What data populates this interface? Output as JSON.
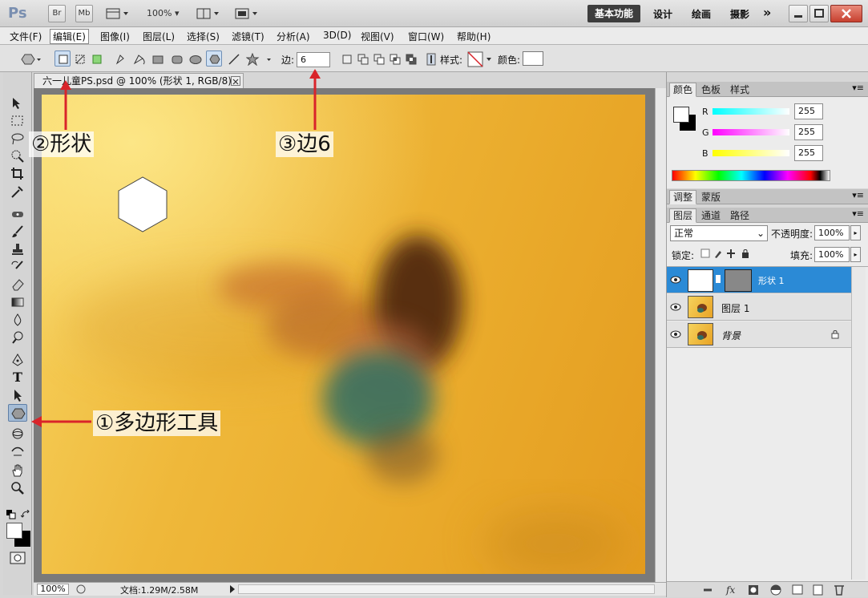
{
  "app": {
    "logo": "Ps",
    "bridge": "Br",
    "minibridge": "Mb",
    "zoom": "100%",
    "workspaces": [
      "基本功能",
      "设计",
      "绘画",
      "摄影"
    ],
    "more": "»"
  },
  "menu": [
    "文件(F)",
    "编辑(E)",
    "图像(I)",
    "图层(L)",
    "选择(S)",
    "滤镜(T)",
    "分析(A)",
    "3D(D)",
    "视图(V)",
    "窗口(W)",
    "帮助(H)"
  ],
  "options": {
    "sides_label": "边:",
    "sides_value": "6",
    "style_label": "样式:",
    "color_label": "颜色:"
  },
  "document": {
    "tab_title": "六一儿童PS.psd @ 100% (形状 1, RGB/8) *",
    "zoom": "100%",
    "doc_info": "文档:1.29M/2.58M"
  },
  "annotations": {
    "polygon_tool": "①多边形工具",
    "shape_mode": "②形状",
    "sides": "③边6"
  },
  "color_panel": {
    "tabs": [
      "颜色",
      "色板",
      "样式"
    ],
    "r_label": "R",
    "g_label": "G",
    "b_label": "B",
    "r": "255",
    "g": "255",
    "b": "255"
  },
  "adjust_panel": {
    "tabs": [
      "调整",
      "蒙版"
    ]
  },
  "layers_panel": {
    "tabs": [
      "图层",
      "通道",
      "路径"
    ],
    "blend_mode": "正常",
    "opacity_label": "不透明度:",
    "opacity": "100%",
    "lock_label": "锁定:",
    "fill_label": "填充:",
    "fill": "100%",
    "layers": [
      {
        "name": "形状 1"
      },
      {
        "name": "图层 1"
      },
      {
        "name": "背景"
      }
    ]
  },
  "colors": {
    "accent": "#2b8ad6",
    "arrow": "#d9242a"
  }
}
